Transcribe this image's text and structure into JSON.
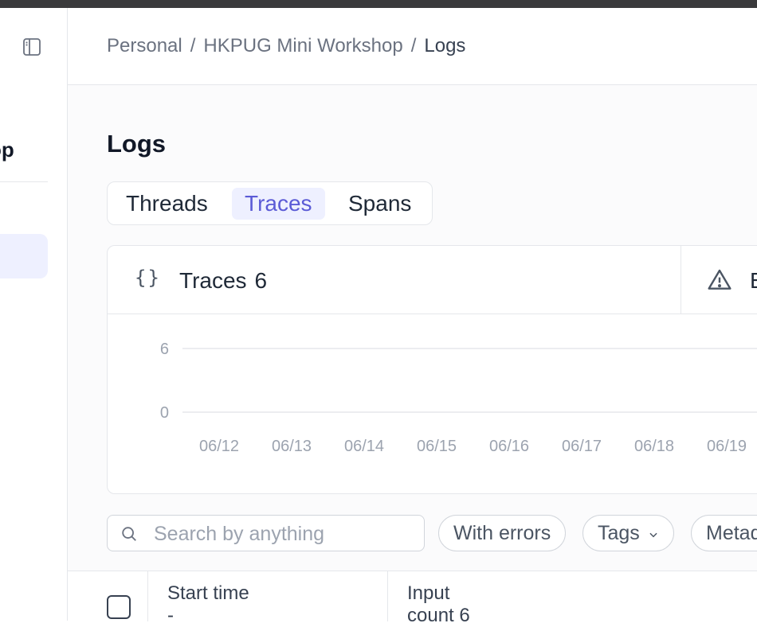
{
  "breadcrumb": {
    "items": [
      "Personal",
      "HKPUG Mini Workshop",
      "Logs"
    ],
    "separator": "/"
  },
  "sidebar": {
    "project_title_fragment": "op"
  },
  "page": {
    "title": "Logs"
  },
  "tabs": [
    {
      "label": "Threads",
      "active": false
    },
    {
      "label": "Traces",
      "active": true
    },
    {
      "label": "Spans",
      "active": false
    }
  ],
  "metrics": {
    "traces_label": "Traces",
    "traces_count": "6",
    "second_label_fragment": "E"
  },
  "chart_data": {
    "type": "line",
    "categories": [
      "06/12",
      "06/13",
      "06/14",
      "06/15",
      "06/16",
      "06/17",
      "06/18",
      "06/19"
    ],
    "y_ticks": [
      "6",
      "0"
    ],
    "ylim": [
      0,
      6
    ],
    "grid": true
  },
  "filters": {
    "search_placeholder": "Search by anything",
    "with_errors": "With errors",
    "tags": "Tags",
    "metadata_fragment": "Metad"
  },
  "table": {
    "columns": [
      {
        "label": "Start time",
        "sub": "-"
      },
      {
        "label": "Input",
        "sub": "count 6"
      }
    ]
  },
  "colors": {
    "accent": "#5b5bd6",
    "accent_bg": "#eef0ff",
    "border": "#e5e7eb",
    "topbar": "#3a3a3c"
  }
}
